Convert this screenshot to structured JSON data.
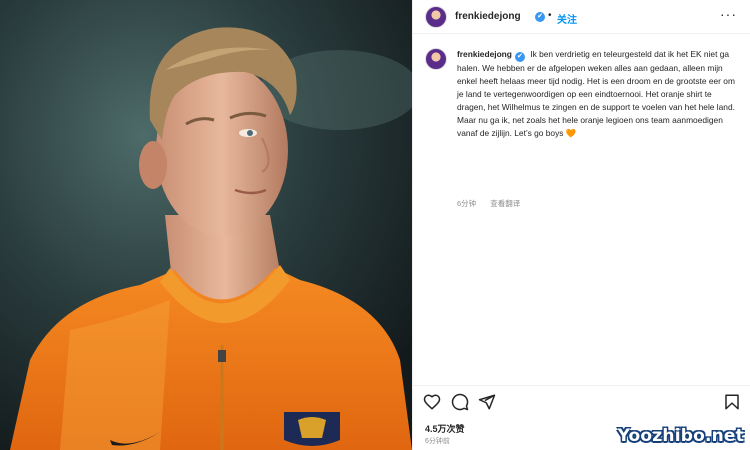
{
  "post": {
    "username": "frenkiedejong",
    "verified_mark": "✔",
    "dot": "•",
    "follow_label": "关注",
    "more_label": "···",
    "caption": "Ik ben verdrietig en teleurgesteld dat ik het EK niet ga halen. We hebben er de afgelopen weken alles aan gedaan, alleen mijn enkel heeft helaas meer tijd nodig. Het is een droom en de grootste eer om je land te vertegenwoordigen op een eindtoernooi. Het oranje shirt te dragen, het Wilhelmus te zingen en de support te voelen van het hele land. Maar nu ga ik, net zoals het hele oranje legioen ons team aanmoedigen vanaf de zijlijn. Let’s go boys",
    "emoji": "🧡",
    "comment_time": "6分钟",
    "translate_label": "查看翻译",
    "likes": "4.5万次赞",
    "post_time": "6分钟前"
  },
  "icons": [
    "heart-icon",
    "comment-icon",
    "share-icon",
    "bookmark-icon"
  ],
  "colors": {
    "accent": "#0095f6",
    "verified": "#3897f0",
    "jersey": "#f07a1a"
  },
  "watermark": "Yoozhibo.net"
}
